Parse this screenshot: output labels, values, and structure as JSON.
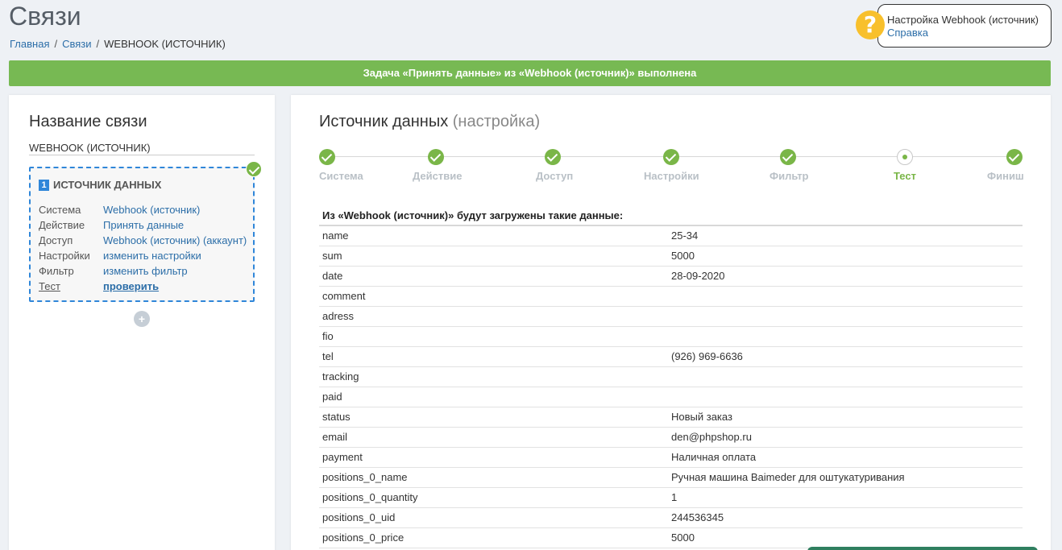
{
  "page": {
    "title": "Связи",
    "breadcrumb": {
      "home": "Главная",
      "links": "Связи",
      "current": "WEBHOOK (ИСТОЧНИК)"
    }
  },
  "help": {
    "title": "Настройка Webhook (источник)",
    "link": "Справка",
    "icon": "question-icon"
  },
  "banner": {
    "text": "Задача «Принять данные» из «Webhook (источник)» выполнена",
    "color": "#77b953"
  },
  "left": {
    "title": "Название связи",
    "name": "WEBHOOK (ИСТОЧНИК)",
    "card": {
      "number": "1",
      "heading": "ИСТОЧНИК ДАННЫХ",
      "rows": [
        {
          "key": "Система",
          "value": "Webhook (источник)"
        },
        {
          "key": "Действие",
          "value": "Принять данные"
        },
        {
          "key": "Доступ",
          "value": "Webhook (источник) (аккаунт)"
        },
        {
          "key": "Настройки",
          "value": "изменить настройки"
        },
        {
          "key": "Фильтр",
          "value": "изменить фильтр"
        },
        {
          "key": "Тест",
          "value": "проверить"
        }
      ]
    },
    "add_label": "+"
  },
  "source": {
    "title": "Источник данных",
    "subtitle": "(настройка)",
    "steps": [
      {
        "label": "Система",
        "state": "done"
      },
      {
        "label": "Действие",
        "state": "done"
      },
      {
        "label": "Доступ",
        "state": "done"
      },
      {
        "label": "Настройки",
        "state": "done"
      },
      {
        "label": "Фильтр",
        "state": "done"
      },
      {
        "label": "Тест",
        "state": "current"
      },
      {
        "label": "Финиш",
        "state": "done"
      }
    ],
    "table_heading": "Из «Webhook (источник)» будут загружены такие данные:",
    "rows": [
      {
        "field": "name",
        "value": "25-34"
      },
      {
        "field": "sum",
        "value": "5000"
      },
      {
        "field": "date",
        "value": "28-09-2020"
      },
      {
        "field": "comment",
        "value": ""
      },
      {
        "field": "adress",
        "value": ""
      },
      {
        "field": "fio",
        "value": ""
      },
      {
        "field": "tel",
        "value": "(926) 969-6636"
      },
      {
        "field": "tracking",
        "value": ""
      },
      {
        "field": "paid",
        "value": ""
      },
      {
        "field": "status",
        "value": "Новый заказ"
      },
      {
        "field": "email",
        "value": "den@phpshop.ru"
      },
      {
        "field": "payment",
        "value": "Наличная оплата"
      },
      {
        "field": "positions_0_name",
        "value": "Ручная машина Baimeder для оштукатуривания"
      },
      {
        "field": "positions_0_quantity",
        "value": "1"
      },
      {
        "field": "positions_0_uid",
        "value": "244536345"
      },
      {
        "field": "positions_0_price",
        "value": "5000"
      }
    ]
  }
}
